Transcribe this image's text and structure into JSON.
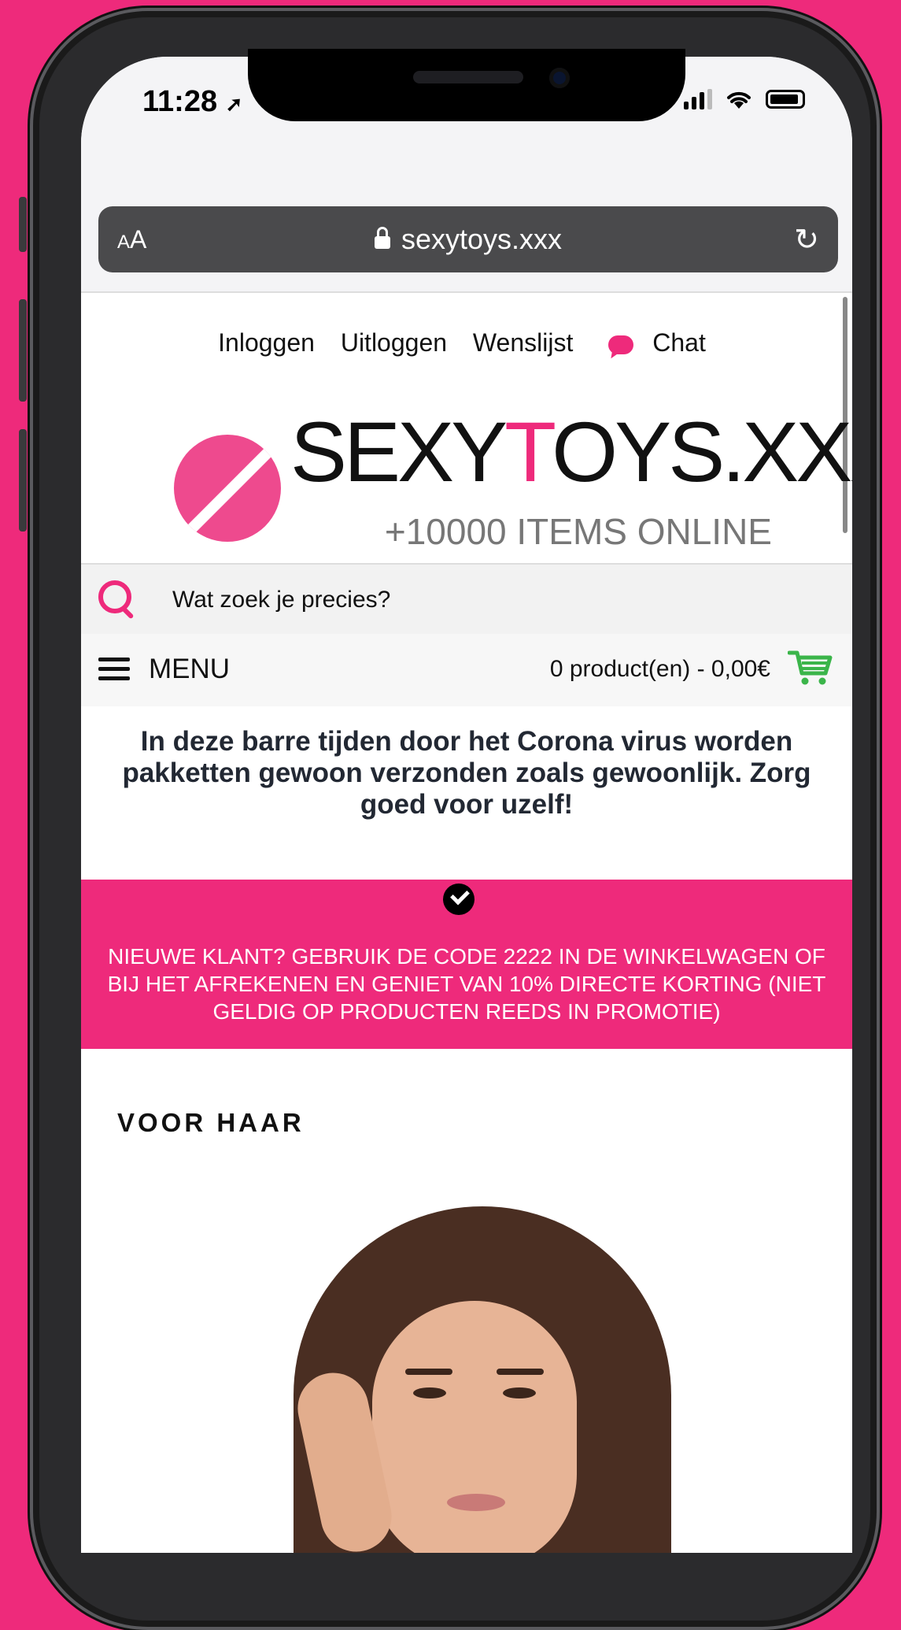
{
  "status_bar": {
    "time": "11:28"
  },
  "browser": {
    "text_size_label": "AA",
    "url": "sexytoys.xxx"
  },
  "header": {
    "links": {
      "login": "Inloggen",
      "logout": "Uitloggen",
      "wishlist": "Wenslijst",
      "chat": "Chat"
    },
    "logo": {
      "part1": "SEXY",
      "accent": "T",
      "part2": "OYS.XXX",
      "tagline": "+10000 ITEMS ONLINE"
    }
  },
  "search": {
    "placeholder": "Wat zoek je precies?"
  },
  "menu": {
    "label": "MENU",
    "cart_summary": "0 product(en) - 0,00€"
  },
  "notice": "In deze barre tijden door het Corona virus worden pakketten gewoon verzonden zoals gewoonlijk. Zorg goed voor uzelf!",
  "promo": "NIEUWE KLANT? GEBRUIK DE CODE 2222 IN DE WINKELWAGEN OF BIJ HET AFREKENEN EN GENIET VAN 10% DIRECTE KORTING (NIET GELDIG OP PRODUCTEN REEDS IN PROMOTIE)",
  "section": {
    "title": "VOOR HAAR"
  },
  "colors": {
    "brand_pink": "#ee2a7b",
    "cart_green": "#3bb54a",
    "notice_text": "#222833"
  },
  "icons": [
    "location-arrow-icon",
    "signal-icon",
    "wifi-icon",
    "battery-icon",
    "lock-icon",
    "reload-icon",
    "chat-icon",
    "search-icon",
    "hamburger-icon",
    "cart-icon",
    "check-circle-icon"
  ]
}
